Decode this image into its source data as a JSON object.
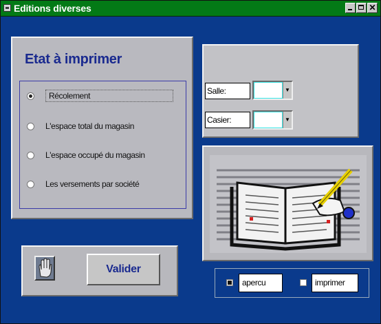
{
  "window": {
    "title": "Editions diverses",
    "close_glyph": "✕",
    "accent_color": "#037a16",
    "background_color": "#0a3a8c"
  },
  "etat": {
    "title": "Etat à imprimer",
    "options": [
      {
        "label": "Récolement",
        "checked": true
      },
      {
        "label": "L'espace total du magasin",
        "checked": false
      },
      {
        "label": "L'espace occupé du magasin",
        "checked": false
      },
      {
        "label": "Les versements par société",
        "checked": false
      }
    ]
  },
  "filters": {
    "salle_label": "Salle:",
    "salle_value": "",
    "casier_label": "Casier:",
    "casier_value": ""
  },
  "illustration": {
    "icon": "open-book-writing-icon"
  },
  "actions": {
    "hand_icon": "hand-icon",
    "valider_label": "Valider"
  },
  "output": {
    "apercu_label": "apercu",
    "apercu_checked": true,
    "imprimer_label": "imprimer",
    "imprimer_checked": false
  }
}
